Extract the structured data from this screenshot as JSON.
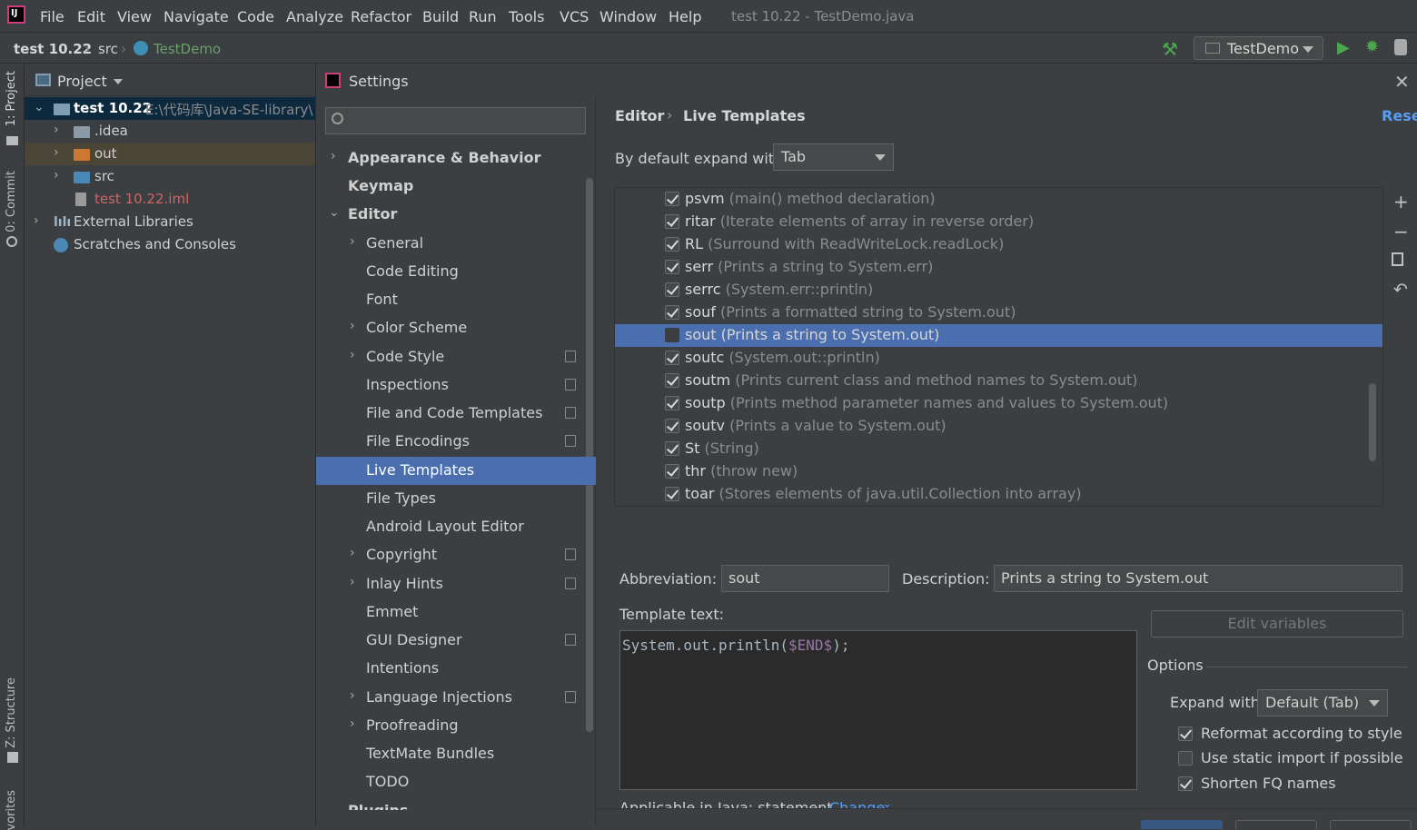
{
  "menubar": {
    "items": [
      "File",
      "Edit",
      "View",
      "Navigate",
      "Code",
      "Analyze",
      "Refactor",
      "Build",
      "Run",
      "Tools",
      "VCS",
      "Window",
      "Help"
    ],
    "window_title": "test 10.22 - TestDemo.java"
  },
  "navbar": {
    "crumbs": [
      "test 10.22",
      "src",
      "TestDemo"
    ],
    "run_config": "TestDemo"
  },
  "left_strip": {
    "tabs": [
      "1: Project",
      "0: Commit",
      "Z: Structure",
      "vorites"
    ]
  },
  "project": {
    "header": "Project",
    "tree": [
      {
        "label": "test 10.22",
        "path": "E:\\代码库\\Java-SE-library\\t"
      },
      {
        "label": ".idea"
      },
      {
        "label": "out"
      },
      {
        "label": "src"
      },
      {
        "label": "test 10.22.iml"
      },
      {
        "label": "External Libraries"
      },
      {
        "label": "Scratches and Consoles"
      }
    ]
  },
  "settings": {
    "title": "Settings",
    "search_placeholder": "",
    "nav": [
      {
        "label": "Appearance & Behavior"
      },
      {
        "label": "Keymap"
      },
      {
        "label": "Editor"
      },
      {
        "label": "General"
      },
      {
        "label": "Code Editing"
      },
      {
        "label": "Font"
      },
      {
        "label": "Color Scheme"
      },
      {
        "label": "Code Style"
      },
      {
        "label": "Inspections"
      },
      {
        "label": "File and Code Templates"
      },
      {
        "label": "File Encodings"
      },
      {
        "label": "Live Templates"
      },
      {
        "label": "File Types"
      },
      {
        "label": "Android Layout Editor"
      },
      {
        "label": "Copyright"
      },
      {
        "label": "Inlay Hints"
      },
      {
        "label": "Emmet"
      },
      {
        "label": "GUI Designer"
      },
      {
        "label": "Intentions"
      },
      {
        "label": "Language Injections"
      },
      {
        "label": "Proofreading"
      },
      {
        "label": "TextMate Bundles"
      },
      {
        "label": "TODO"
      },
      {
        "label": "Plugins"
      }
    ],
    "breadcrumb": {
      "parent": "Editor",
      "current": "Live Templates"
    },
    "reset_label": "Reset",
    "expand_label": "By default expand with",
    "expand_value": "Tab",
    "templates": [
      {
        "abbr": "psvm",
        "desc": "(main() method declaration)",
        "checked": true
      },
      {
        "abbr": "ritar",
        "desc": "(Iterate elements of array in reverse order)",
        "checked": true
      },
      {
        "abbr": "RL",
        "desc": "(Surround with ReadWriteLock.readLock)",
        "checked": true
      },
      {
        "abbr": "serr",
        "desc": "(Prints a string to System.err)",
        "checked": true
      },
      {
        "abbr": "serrc",
        "desc": "(System.err::println)",
        "checked": true
      },
      {
        "abbr": "souf",
        "desc": "(Prints a formatted string to System.out)",
        "checked": true
      },
      {
        "abbr": "sout",
        "desc": "(Prints a string to System.out)",
        "checked": false
      },
      {
        "abbr": "soutc",
        "desc": "(System.out::println)",
        "checked": true
      },
      {
        "abbr": "soutm",
        "desc": "(Prints current class and method names to System.out)",
        "checked": true
      },
      {
        "abbr": "soutp",
        "desc": "(Prints method parameter names and values to System.out)",
        "checked": true
      },
      {
        "abbr": "soutv",
        "desc": "(Prints a value to System.out)",
        "checked": true
      },
      {
        "abbr": "St",
        "desc": "(String)",
        "checked": true
      },
      {
        "abbr": "thr",
        "desc": "(throw new)",
        "checked": true
      },
      {
        "abbr": "toar",
        "desc": "(Stores elements of java.util.Collection into array)",
        "checked": true
      }
    ],
    "abbreviation_label": "Abbreviation:",
    "abbreviation_value": "sout",
    "description_label": "Description:",
    "description_value": "Prints a string to System.out",
    "template_text_label": "Template text:",
    "template_code_prefix": "System.out.println(",
    "template_code_var": "$END$",
    "template_code_suffix": ");",
    "edit_variables_label": "Edit variables",
    "options_label": "Options",
    "expand_with_label": "Expand with",
    "expand_with_value": "Default (Tab)",
    "options": [
      {
        "label": "Reformat according to style",
        "checked": true
      },
      {
        "label": "Use static import if possible",
        "checked": false
      },
      {
        "label": "Shorten FQ names",
        "checked": true
      }
    ],
    "applicable_label": "Applicable in Java: statement.",
    "change_label": "Change"
  },
  "colors": {
    "selection": "#4b6eaf",
    "run_green": "#4aa84e",
    "link_blue": "#589df6",
    "out_folder": "#cc7832",
    "iml_red": "#cc6666"
  }
}
